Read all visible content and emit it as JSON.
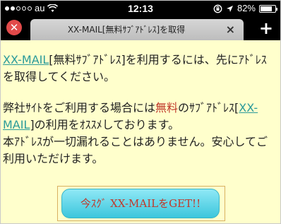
{
  "status_bar": {
    "carrier": "au",
    "time": "12:13",
    "battery_percent_label": "82%",
    "battery_level": 0.82,
    "signal_bars_filled": 2,
    "signal_bars_total": 5
  },
  "tab_bar": {
    "close_all_icon": "x-circle-icon",
    "tab_title": "XX-MAIL[無料ｻﾌﾞｱﾄﾞﾚｽ]を取得",
    "tab_close_label": "×",
    "new_tab_label": "+"
  },
  "content": {
    "para1_link": "XX-MAIL",
    "para1_text": "[無料ｻﾌﾞｱﾄﾞﾚｽ]を利用するには、先にｱﾄﾞﾚｽを取得してください。",
    "para2_prefix": "弊社ｻｲﾄをご利用する場合には",
    "para2_red": "無料",
    "para2_mid": "のｻﾌﾞｱﾄﾞﾚｽ[",
    "para2_link": "XX-MAIL",
    "para2_suffix": "]の利用をｵｽｽﾒしております。",
    "para3_text": "本ｱﾄﾞﾚｽが一切漏れることはありません。安心してご利用いただけます。"
  },
  "cta": {
    "label": "今ｽｸﾞ XX-MAILをGET!!"
  },
  "colors": {
    "background": "#ffffcc",
    "link": "#2a9a9a",
    "accent_red": "#c0392b",
    "button": "#3cc6dc"
  }
}
